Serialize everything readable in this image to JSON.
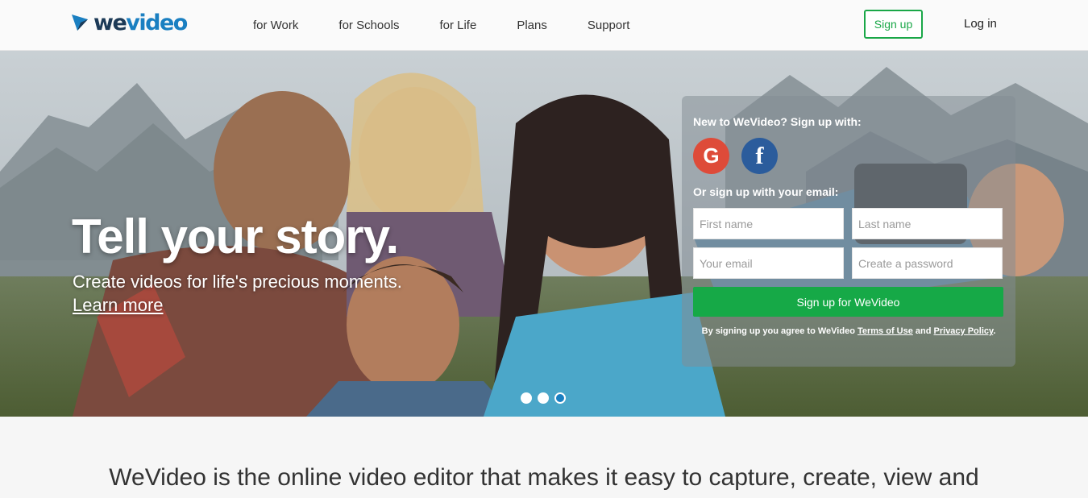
{
  "header": {
    "logo_text_a": "we",
    "logo_text_b": "video",
    "nav": [
      "for Work",
      "for Schools",
      "for Life",
      "Plans",
      "Support"
    ],
    "signup_label": "Sign up",
    "login_label": "Log in"
  },
  "hero": {
    "title": "Tell your story.",
    "subtitle": "Create videos for life's precious moments.",
    "link": "Learn more",
    "carousel": {
      "count": 3,
      "active": 3
    }
  },
  "signup_panel": {
    "social_heading": "New to WeVideo? Sign up with:",
    "google_icon": "google-icon",
    "google_glyph": "G",
    "facebook_icon": "facebook-icon",
    "facebook_glyph": "f",
    "email_heading": "Or sign up with your email:",
    "first_name_placeholder": "First name",
    "last_name_placeholder": "Last name",
    "email_placeholder": "Your email",
    "password_placeholder": "Create a password",
    "submit_label": "Sign up for WeVideo",
    "terms_prefix": "By signing up you agree to WeVideo ",
    "terms_link": "Terms of Use",
    "terms_and": " and ",
    "privacy_link": "Privacy Policy",
    "terms_suffix": "."
  },
  "tagline": "WeVideo is the online video editor that makes it easy to capture, create, view and",
  "colors": {
    "brand_green": "#1aa748",
    "brand_blue": "#1a7fc1",
    "google_red": "#de4b39",
    "facebook_blue": "#2b5c9c"
  }
}
